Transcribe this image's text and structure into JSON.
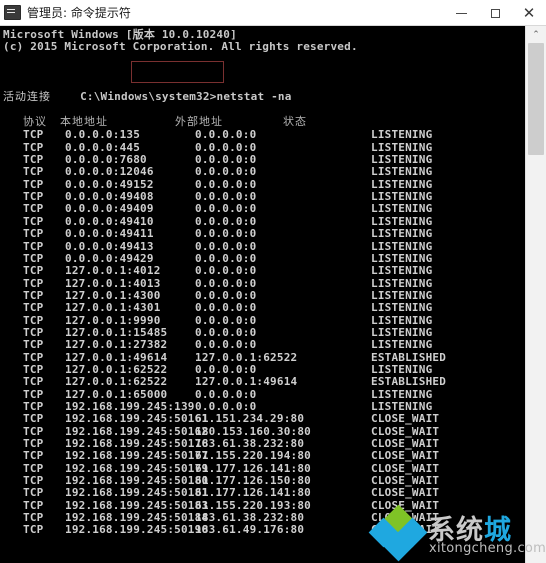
{
  "window": {
    "title": "管理员: 命令提示符",
    "icon": "console-icon",
    "controls": {
      "minimize": "–",
      "maximize": "❐",
      "close": "✕"
    }
  },
  "console": {
    "banner": [
      "Microsoft Windows [版本 10.0.10240]",
      "(c) 2015 Microsoft Corporation. All rights reserved."
    ],
    "prompt": "C:\\Windows\\system32>",
    "command": "netstat -na",
    "highlight_color": "#7a3030",
    "section_title": "活动连接",
    "headers": {
      "protocol": "协议",
      "local_address": "本地地址",
      "foreign_address": "外部地址",
      "state": "状态"
    },
    "rows": [
      {
        "proto": "TCP",
        "local": "0.0.0.0:135",
        "foreign": "0.0.0.0:0",
        "state": "LISTENING"
      },
      {
        "proto": "TCP",
        "local": "0.0.0.0:445",
        "foreign": "0.0.0.0:0",
        "state": "LISTENING"
      },
      {
        "proto": "TCP",
        "local": "0.0.0.0:7680",
        "foreign": "0.0.0.0:0",
        "state": "LISTENING"
      },
      {
        "proto": "TCP",
        "local": "0.0.0.0:12046",
        "foreign": "0.0.0.0:0",
        "state": "LISTENING"
      },
      {
        "proto": "TCP",
        "local": "0.0.0.0:49152",
        "foreign": "0.0.0.0:0",
        "state": "LISTENING"
      },
      {
        "proto": "TCP",
        "local": "0.0.0.0:49408",
        "foreign": "0.0.0.0:0",
        "state": "LISTENING"
      },
      {
        "proto": "TCP",
        "local": "0.0.0.0:49409",
        "foreign": "0.0.0.0:0",
        "state": "LISTENING"
      },
      {
        "proto": "TCP",
        "local": "0.0.0.0:49410",
        "foreign": "0.0.0.0:0",
        "state": "LISTENING"
      },
      {
        "proto": "TCP",
        "local": "0.0.0.0:49411",
        "foreign": "0.0.0.0:0",
        "state": "LISTENING"
      },
      {
        "proto": "TCP",
        "local": "0.0.0.0:49413",
        "foreign": "0.0.0.0:0",
        "state": "LISTENING"
      },
      {
        "proto": "TCP",
        "local": "0.0.0.0:49429",
        "foreign": "0.0.0.0:0",
        "state": "LISTENING"
      },
      {
        "proto": "TCP",
        "local": "127.0.0.1:4012",
        "foreign": "0.0.0.0:0",
        "state": "LISTENING"
      },
      {
        "proto": "TCP",
        "local": "127.0.0.1:4013",
        "foreign": "0.0.0.0:0",
        "state": "LISTENING"
      },
      {
        "proto": "TCP",
        "local": "127.0.0.1:4300",
        "foreign": "0.0.0.0:0",
        "state": "LISTENING"
      },
      {
        "proto": "TCP",
        "local": "127.0.0.1:4301",
        "foreign": "0.0.0.0:0",
        "state": "LISTENING"
      },
      {
        "proto": "TCP",
        "local": "127.0.0.1:9990",
        "foreign": "0.0.0.0:0",
        "state": "LISTENING"
      },
      {
        "proto": "TCP",
        "local": "127.0.0.1:15485",
        "foreign": "0.0.0.0:0",
        "state": "LISTENING"
      },
      {
        "proto": "TCP",
        "local": "127.0.0.1:27382",
        "foreign": "0.0.0.0:0",
        "state": "LISTENING"
      },
      {
        "proto": "TCP",
        "local": "127.0.0.1:49614",
        "foreign": "127.0.0.1:62522",
        "state": "ESTABLISHED"
      },
      {
        "proto": "TCP",
        "local": "127.0.0.1:62522",
        "foreign": "0.0.0.0:0",
        "state": "LISTENING"
      },
      {
        "proto": "TCP",
        "local": "127.0.0.1:62522",
        "foreign": "127.0.0.1:49614",
        "state": "ESTABLISHED"
      },
      {
        "proto": "TCP",
        "local": "127.0.0.1:65000",
        "foreign": "0.0.0.0:0",
        "state": "LISTENING"
      },
      {
        "proto": "TCP",
        "local": "192.168.199.245:139",
        "foreign": "0.0.0.0:0",
        "state": "LISTENING"
      },
      {
        "proto": "TCP",
        "local": "192.168.199.245:50161",
        "foreign": "61.151.234.29:80",
        "state": "CLOSE_WAIT"
      },
      {
        "proto": "TCP",
        "local": "192.168.199.245:50162",
        "foreign": "180.153.160.30:80",
        "state": "CLOSE_WAIT"
      },
      {
        "proto": "TCP",
        "local": "192.168.199.245:50176",
        "foreign": "183.61.38.232:80",
        "state": "CLOSE_WAIT"
      },
      {
        "proto": "TCP",
        "local": "192.168.199.245:50177",
        "foreign": "61.155.220.194:80",
        "state": "CLOSE_WAIT"
      },
      {
        "proto": "TCP",
        "local": "192.168.199.245:50179",
        "foreign": "61.177.126.141:80",
        "state": "CLOSE_WAIT"
      },
      {
        "proto": "TCP",
        "local": "192.168.199.245:50180",
        "foreign": "61.177.126.150:80",
        "state": "CLOSE_WAIT"
      },
      {
        "proto": "TCP",
        "local": "192.168.199.245:50181",
        "foreign": "61.177.126.141:80",
        "state": "CLOSE_WAIT"
      },
      {
        "proto": "TCP",
        "local": "192.168.199.245:50183",
        "foreign": "61.155.220.193:80",
        "state": "CLOSE_WAIT"
      },
      {
        "proto": "TCP",
        "local": "192.168.199.245:50184",
        "foreign": "183.61.38.232:80",
        "state": "CLOSE_WAIT"
      },
      {
        "proto": "TCP",
        "local": "192.168.199.245:50190",
        "foreign": "183.61.49.176:80",
        "state": "CLOSE_WAIT"
      }
    ]
  },
  "scrollbar": {
    "up_arrow": "⌃"
  },
  "watermark": {
    "cn_text_1": "系统",
    "cn_text_2": "城",
    "en_text": "xitongcheng.com",
    "accent_green": "#7fc326",
    "accent_blue": "#1fa8e0"
  }
}
